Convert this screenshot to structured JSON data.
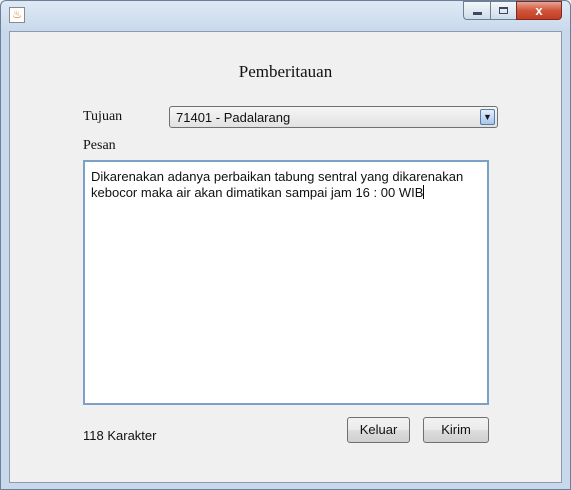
{
  "window": {
    "icon": "java-icon",
    "controls": {
      "close_glyph": "x"
    }
  },
  "form": {
    "title": "Pemberitauan",
    "tujuan_label": "Tujuan",
    "tujuan_value": "71401 - Padalarang",
    "pesan_label": "Pesan",
    "pesan_text": "Dikarenakan adanya perbaikan tabung sentral yang dikarenakan kebocor maka air akan dimatikan sampai jam 16 : 00 WIB",
    "char_count": "118 Karakter"
  },
  "buttons": {
    "keluar": "Keluar",
    "kirim": "Kirim"
  }
}
